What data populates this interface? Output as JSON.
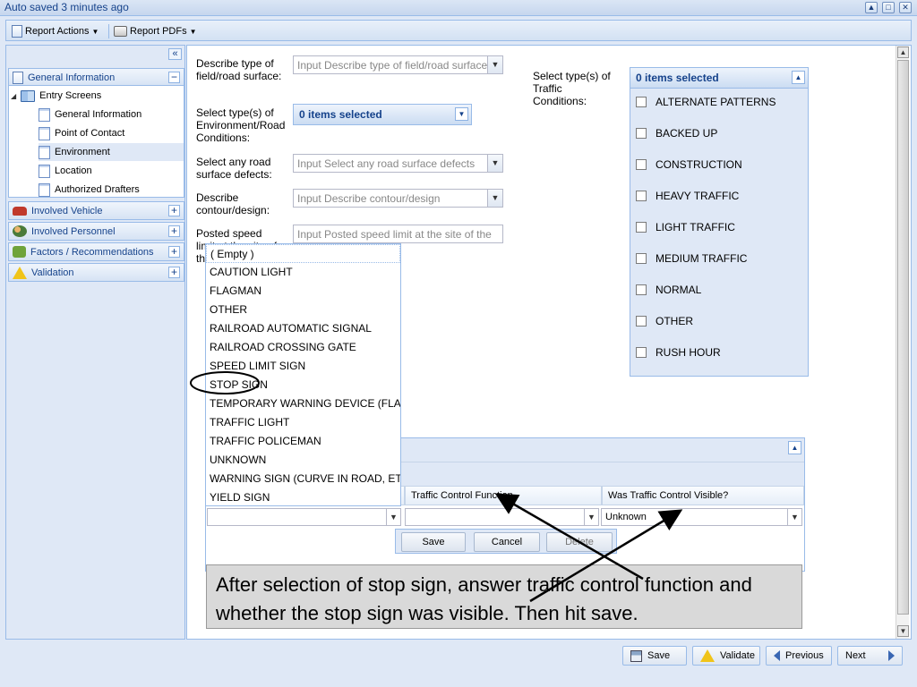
{
  "window": {
    "title": "Auto saved 3 minutes ago",
    "controls": {
      "restore": "▲",
      "maximize": "□",
      "close": "✕"
    }
  },
  "toolbar": {
    "report_actions": "Report Actions",
    "report_pdfs": "Report PDFs"
  },
  "sidebar": {
    "collapse_glyph": "«",
    "general_information": "General Information",
    "tree": {
      "root": "Entry Screens",
      "items": [
        "General Information",
        "Point of Contact",
        "Environment",
        "Location",
        "Authorized Drafters"
      ],
      "selected": "Environment"
    },
    "sections": [
      "Involved Vehicle",
      "Involved Personnel",
      "Factors / Recommendations",
      "Validation"
    ]
  },
  "form": {
    "surface_type": {
      "label": "Describe type of field/road surface:",
      "placeholder": "Input Describe type of field/road surface"
    },
    "env_conditions": {
      "label": "Select type(s) of Environment/Road Conditions:",
      "value": "0 items selected"
    },
    "surface_defects": {
      "label": "Select any road surface defects:",
      "placeholder": "Input Select any road surface defects"
    },
    "contour": {
      "label": "Describe contour/design:",
      "placeholder": "Input Describe contour/design"
    },
    "speed_limit": {
      "label": "Posted speed limit at the site of the",
      "placeholder": "Input Posted speed limit at the site of the"
    },
    "traffic_conditions": {
      "label": "Select type(s) of Traffic Conditions:",
      "value": "0 items selected",
      "options": [
        "ALTERNATE PATTERNS",
        "BACKED UP",
        "CONSTRUCTION",
        "HEAVY TRAFFIC",
        "LIGHT TRAFFIC",
        "MEDIUM TRAFFIC",
        "NORMAL",
        "OTHER",
        "RUSH HOUR"
      ]
    }
  },
  "dropdown": {
    "items": [
      "( Empty )",
      "CAUTION LIGHT",
      "FLAGMAN",
      "OTHER",
      "RAILROAD AUTOMATIC SIGNAL",
      "RAILROAD CROSSING GATE",
      "SPEED LIMIT SIGN",
      "STOP SIGN",
      "TEMPORARY WARNING DEVICE (FLAG",
      "TRAFFIC LIGHT",
      "TRAFFIC POLICEMAN",
      "UNKNOWN",
      "WARNING SIGN (CURVE IN ROAD, ETC",
      "YIELD SIGN"
    ],
    "highlighted": "STOP SIGN"
  },
  "grid": {
    "columns": [
      "Traffic Control Function",
      "Was Traffic Control Visible?"
    ],
    "visible_value": "Unknown",
    "buttons": {
      "save": "Save",
      "cancel": "Cancel",
      "delete": "Delete"
    }
  },
  "callout": {
    "text": "After selection of stop sign, answer traffic control function and whether the stop sign was visible.  Then hit save."
  },
  "footer": {
    "save": "Save",
    "validate": "Validate",
    "previous": "Previous",
    "next": "Next"
  }
}
